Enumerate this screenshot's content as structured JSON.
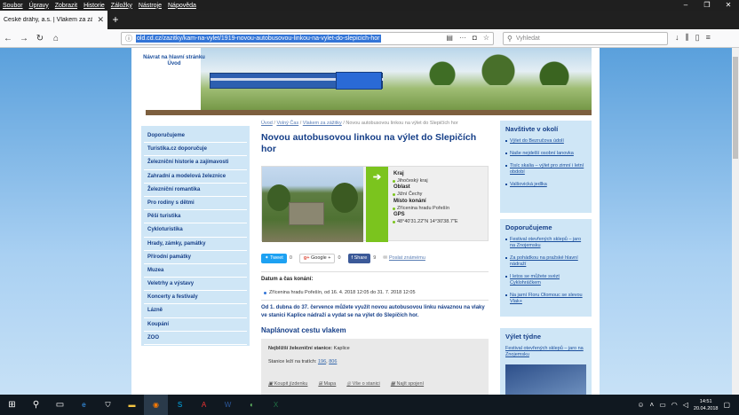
{
  "menubar": {
    "items": [
      "Soubor",
      "Úpravy",
      "Zobrazit",
      "Historie",
      "Záložky",
      "Nástroje",
      "Nápověda"
    ]
  },
  "window": {
    "minimize": "–",
    "maximize": "❐",
    "close": "✕"
  },
  "tab": {
    "title": "České dráhy, a.s. | Vlakem za zážit",
    "close": "✕",
    "new": "+"
  },
  "nav": {
    "back": "←",
    "forward": "→",
    "reload": "↻",
    "home": "⌂",
    "url": "old.cd.cz/zazitky/kam-na-vylet/1919-novou-autobusovou-linkou-na-vylet-do-slepicich-hor",
    "search_placeholder": "Vyhledat"
  },
  "banner": {
    "back_link": "Návrat na hlavní stránku Úvod"
  },
  "leftnav": {
    "items": [
      "Doporučujeme",
      "Turistika.cz doporučuje",
      "Železniční historie a zajímavosti",
      "Zahradní a modelová železnice",
      "Železniční romantika",
      "Pro rodiny s dětmi",
      "Pěší turistika",
      "Cykloturistika",
      "Hrady, zámky, památky",
      "Přírodní památky",
      "Muzea",
      "Veletrhy a výstavy",
      "Koncerty a festivaly",
      "Lázně",
      "Koupání",
      "ZOO"
    ]
  },
  "main": {
    "breadcrumb": {
      "b1": "Úvod",
      "b2": "Volný Čas",
      "b3": "Vlakem za zážitky",
      "current": "Novou autobusovou linkou na výlet do Slepičích hor"
    },
    "title": "Novou autobusovou linkou na výlet do Slepičích hor",
    "facts": {
      "kraj_label": "Kraj",
      "kraj": "Jihočeský kraj",
      "oblast_label": "Oblast",
      "oblast": "Jižní Čechy",
      "misto_label": "Místo konání",
      "misto": "Zřícenina hradu Pořešín",
      "gps_label": "GPS",
      "gps": "48°40'31.22\"N 14°30'38.7\"E"
    },
    "share": {
      "tweet": "Tweet",
      "tweet_count": "0",
      "google": "Google +",
      "google_count": "0",
      "fb": "Share",
      "fb_count": "9",
      "send": "Poslat známému"
    },
    "dates_heading": "Datum a čas konání:",
    "dates_value": "Zřícenina hradu Pořešín, od 16. 4. 2018 12:05 do 31. 7. 2018 12:05",
    "description": "Od 1. dubna do 37. července můžete využít novou autobusovou linku návaznou na vlaky ve stanici Kaplice nádraží a vydat se na výlet do Slepičích hor.",
    "plan_heading": "Naplánovat cestu vlakem",
    "plan": {
      "station_label": "Nejbližší železniční stanice:",
      "station": "Kaplice",
      "lines_label": "Stanice leží na tratích:",
      "line1": "196",
      "line2": "806",
      "buy": "Koupit jízdenku",
      "map": "Mapa",
      "all": "Vše o stanici",
      "search": "Najít spojení"
    }
  },
  "right": {
    "box1": {
      "title": "Navštivte v okolí",
      "links": [
        "Výlet do Bezručova údolí",
        "Naše nejdelší osobní lanovka",
        "Tisíc skalia – výlet pro zimní i letní období",
        "Valšovická jedlka"
      ]
    },
    "box2": {
      "title": "Doporučujeme",
      "links": [
        "Festival otevřených sklepů – jaro na Znojemsku",
        "Za pohádkou na pražské hlavní nádraží",
        "I letos se můžete svézt Cyklohráčkem",
        "Na jarní Floru Olomouc se slevou Vlak+"
      ]
    },
    "box3": {
      "title": "Výlet týdne",
      "link": "Festival otevřených sklepů – jaro na Znojemsku"
    }
  },
  "taskbar": {
    "time": "14:51",
    "date": "20.04.2018"
  }
}
